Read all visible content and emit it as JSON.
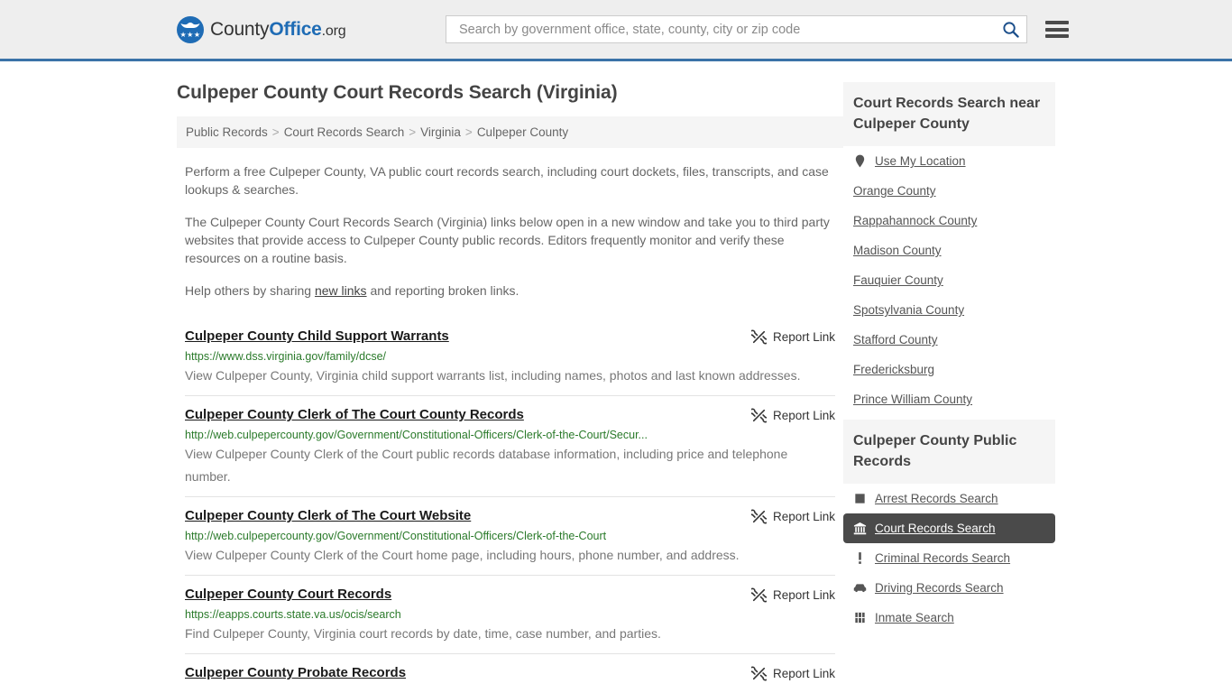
{
  "header": {
    "logo": {
      "name": "CountyOffice.org",
      "part_county": "County",
      "part_office": "Office",
      "part_org": ".org"
    },
    "search": {
      "placeholder": "Search by government office, state, county, city or zip code",
      "value": "",
      "icon": "search-icon"
    },
    "menu_icon": "hamburger-menu-icon",
    "accent_color": "#3a72a8",
    "background_color": "#eeeeee"
  },
  "page": {
    "title": "Culpeper County Court Records Search (Virginia)",
    "breadcrumb": [
      "Public Records",
      "Court Records Search",
      "Virginia",
      "Culpeper County"
    ],
    "breadcrumb_separator": ">",
    "intro": {
      "p1": "Perform a free Culpeper County, VA public court records search, including court dockets, files, transcripts, and case lookups & searches.",
      "p2": "The Culpeper County Court Records Search (Virginia) links below open in a new window and take you to third party websites that provide access to Culpeper County public records. Editors frequently monitor and verify these resources on a routine basis.",
      "p3_before": "Help others by sharing ",
      "p3_link": "new links",
      "p3_after": " and reporting broken links."
    }
  },
  "results": {
    "report_label": "Report Link",
    "report_icon": "broken-link-icon",
    "items": [
      {
        "title": "Culpeper County Child Support Warrants",
        "url": "https://www.dss.virginia.gov/family/dcse/",
        "description": "View Culpeper County, Virginia child support warrants list, including names, photos and last known addresses."
      },
      {
        "title": "Culpeper County Clerk of The Court County Records",
        "url": "http://web.culpepercounty.gov/Government/Constitutional-Officers/Clerk-of-the-Court/Secur...",
        "description": "View Culpeper County Clerk of the Court public records database information, including price and telephone number."
      },
      {
        "title": "Culpeper County Clerk of The Court Website",
        "url": "http://web.culpepercounty.gov/Government/Constitutional-Officers/Clerk-of-the-Court",
        "description": "View Culpeper County Clerk of the Court home page, including hours, phone number, and address."
      },
      {
        "title": "Culpeper County Court Records",
        "url": "https://eapps.courts.state.va.us/ocis/search",
        "description": "Find Culpeper County, Virginia court records by date, time, case number, and parties."
      },
      {
        "title": "Culpeper County Probate Records",
        "url": "",
        "description": ""
      }
    ]
  },
  "sidebar": {
    "nearby": {
      "heading": "Court Records Search near Culpeper County",
      "items": [
        {
          "label": "Use My Location",
          "icon": "map-pin-icon"
        },
        {
          "label": "Orange County",
          "icon": ""
        },
        {
          "label": "Rappahannock County",
          "icon": ""
        },
        {
          "label": "Madison County",
          "icon": ""
        },
        {
          "label": "Fauquier County",
          "icon": ""
        },
        {
          "label": "Spotsylvania County",
          "icon": ""
        },
        {
          "label": "Stafford County",
          "icon": ""
        },
        {
          "label": "Fredericksburg",
          "icon": ""
        },
        {
          "label": "Prince William County",
          "icon": ""
        }
      ]
    },
    "public_records": {
      "heading": "Culpeper County Public Records",
      "active_index": 1,
      "active_color": "#4a4a4a",
      "items": [
        {
          "label": "Arrest Records Search",
          "icon": "fingerprint-square-icon"
        },
        {
          "label": "Court Records Search",
          "icon": "courthouse-icon"
        },
        {
          "label": "Criminal Records Search",
          "icon": "exclamation-icon"
        },
        {
          "label": "Driving Records Search",
          "icon": "car-icon"
        },
        {
          "label": "Inmate Search",
          "icon": "jail-door-icon"
        }
      ]
    }
  }
}
